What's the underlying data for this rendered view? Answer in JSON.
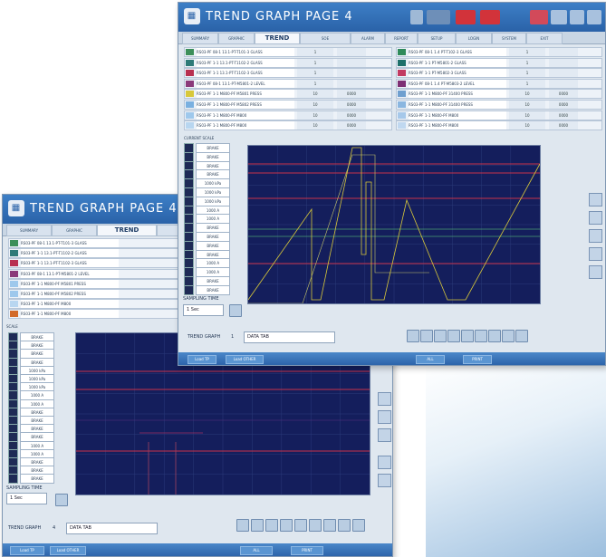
{
  "front": {
    "title": "TREND GRAPH PAGE 4",
    "tabs": [
      "SUMMARY",
      "GRAPHIC",
      "TREND",
      "SOE",
      "ALARM",
      "REPORT",
      "SETUP",
      "LOGIN",
      "SYSTEM",
      "EXIT"
    ],
    "active_tab": "TREND",
    "tags_left": [
      {
        "name": "RS03-PF 08-1 13.1-PT-T101-3 GLASS",
        "v1": "1",
        "v2": "",
        "color": "#3c8f5a"
      },
      {
        "name": "RS03-PF 1-1 13.1-PT-T1102-2 GLASS",
        "v1": "1",
        "v2": "",
        "color": "#2d7a78"
      },
      {
        "name": "RS03-PF 1-1 13.1-PT-T1102-3 GLASS",
        "v1": "1",
        "v2": "",
        "color": "#b83050"
      },
      {
        "name": "RS03-PF 08-1 13.1-PT-M5801-2 LEVEL",
        "v1": "1",
        "v2": "",
        "color": "#8b3a7a"
      },
      {
        "name": "RS03-PF 1-1 M800-PF M5801 PRESS",
        "v1": "10",
        "v2": "0000",
        "color": "#d8c83a"
      },
      {
        "name": "RS03-PF 1-1 M800-PF M5802 PRESS",
        "v1": "10",
        "v2": "0000",
        "color": "#7ab0e0"
      },
      {
        "name": "RS03-PF 1-1 M800-PF M800",
        "v1": "10",
        "v2": "0000",
        "color": "#9ec8ec"
      },
      {
        "name": "RS03-PF 1-1 M800-PF M800",
        "v1": "10",
        "v2": "0000",
        "color": "#b8d6f0"
      }
    ],
    "tags_right": [
      {
        "name": "RS03-PF 08-1 1.4 PT-T102-3 GLASS",
        "v1": "1",
        "v2": "",
        "color": "#2f8a5a"
      },
      {
        "name": "RS03-PF 1-1 PT-M5801-2 GLASS",
        "v1": "1",
        "v2": "",
        "color": "#1d6f6a"
      },
      {
        "name": "RS03-PF 1-1 PT-M5802-3 GLASS",
        "v1": "1",
        "v2": "",
        "color": "#c23a62"
      },
      {
        "name": "RS03-PF 08-1 1.4 PT-M5803-2 LEVEL",
        "v1": "1",
        "v2": "",
        "color": "#7d2f74"
      },
      {
        "name": "RS03-PF 1-1 M800-PF 31400 PRESS",
        "v1": "10",
        "v2": "0000",
        "color": "#6f9fcf"
      },
      {
        "name": "RS03-PF 1-1 M800-PF 31400 PRESS",
        "v1": "10",
        "v2": "0000",
        "color": "#8ab6e0"
      },
      {
        "name": "RS03-PF 1-1 M800-PF M800",
        "v1": "10",
        "v2": "0000",
        "color": "#a6c8ea"
      },
      {
        "name": "RS03-PF 1-1 M800-PF M800",
        "v1": "10",
        "v2": "0000",
        "color": "#c0d8f0"
      }
    ],
    "scale_head": "CURRENT SCALE",
    "scales": [
      "BRAKE",
      "BRAKE",
      "BRAKE",
      "BRAKE",
      "1000 kPa",
      "1000 kPa",
      "1000 kPa",
      "1000 A",
      "1000 A",
      "BRAKE",
      "BRAKE",
      "BRAKE",
      "BRAKE",
      "1000 A",
      "1000 A",
      "BRAKE",
      "BRAKE"
    ],
    "time_label": "SAMPLING TIME",
    "time_value": "1 Sec",
    "graph_label": "TREND GRAPH",
    "graph_no": "1",
    "graph_name": "DATA TAB",
    "status": [
      "Load TP",
      "Load OTHER",
      "ALL",
      "PRINT"
    ]
  },
  "back": {
    "title": "TREND GRAPH PAGE 4",
    "tabs": [
      "SUMMARY",
      "GRAPHIC",
      "TREND",
      "SOE"
    ],
    "active_tab": "TREND",
    "tags": [
      {
        "name": "RS03-PF 08-1 13.1-PT-T101-3 GLASS",
        "color": "#3c8f5a"
      },
      {
        "name": "RS03-PF 1-1 13.1-PT-T1102-2 GLASS",
        "color": "#2d7a78"
      },
      {
        "name": "RS03-PF 1-1 13.1-PT-T1102-3 GLASS",
        "color": "#b83050"
      },
      {
        "name": "RS03-PF 08-1 13.1-PT-M5801-2 LEVEL",
        "color": "#8b3a7a"
      },
      {
        "name": "RS03-PF 1-1 M800-PF M5801 PRESS",
        "color": "#9ec8ec"
      },
      {
        "name": "RS03-PF 1-1 M800-PF M5802 PRESS",
        "color": "#9ec8ec"
      },
      {
        "name": "RS03-PF 1-1 M800-PF M800",
        "color": "#b8d6f0"
      },
      {
        "name": "RS03-PF 1-1 M800-PF M800",
        "color": "#d26a2a"
      }
    ],
    "scale_head": "SCALE",
    "scales": [
      "BRAKE",
      "BRAKE",
      "BRAKE",
      "BRAKE",
      "1000 kPa",
      "1000 kPa",
      "1000 kPa",
      "1000 A",
      "1000 A",
      "BRAKE",
      "BRAKE",
      "BRAKE",
      "BRAKE",
      "1000 A",
      "1000 A",
      "BRAKE",
      "BRAKE",
      "BRAKE"
    ],
    "time_label": "SAMPLING TIME",
    "time_value": "1 Sec",
    "graph_label": "TREND GRAPH",
    "graph_no": "4",
    "graph_name": "DATA TAB",
    "status": [
      "Load TP",
      "Load OTHER",
      "ALL",
      "PRINT"
    ]
  },
  "colors": {
    "title_bar": "#2a62a8",
    "plot_bg": "#141e5c",
    "trace_red": "#c8324a",
    "trace_yellow": "#d8c83a"
  }
}
